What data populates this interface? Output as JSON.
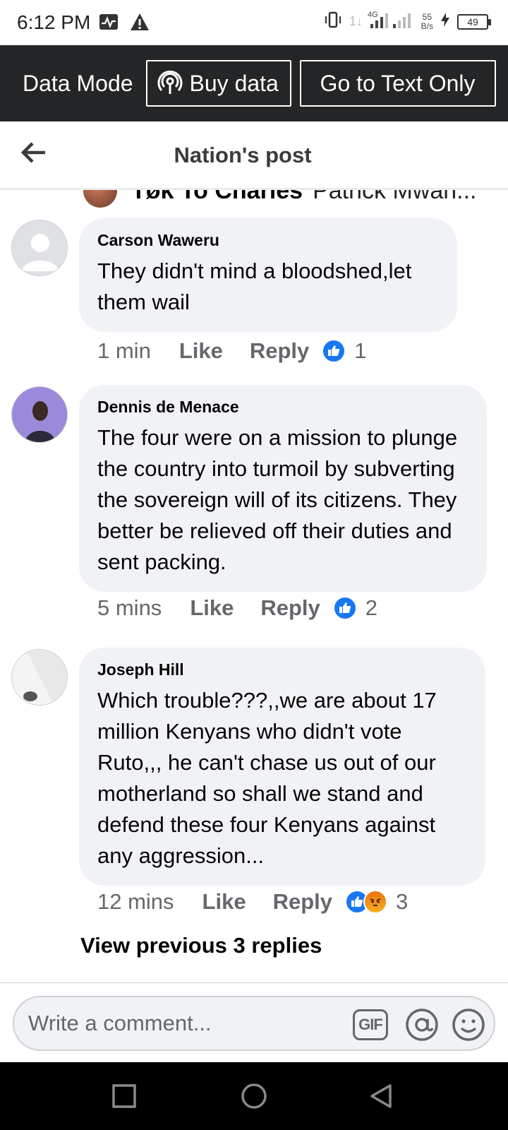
{
  "status_bar": {
    "time": "6:12 PM",
    "network_type": "4G",
    "net_speed_value": "55",
    "net_speed_unit": "B/s",
    "battery": "49"
  },
  "data_bar": {
    "mode_label": "Data Mode",
    "buy_label": "Buy data",
    "text_only_label": "Go to Text Only"
  },
  "header": {
    "title": "Nation's post"
  },
  "partial_comment": {
    "author": "Tøk To Charles",
    "text": "Patrick Mwan..."
  },
  "comments": [
    {
      "author": "Carson Waweru",
      "text": "They didn't mind a bloodshed,let them wail",
      "time": "1 min",
      "like_label": "Like",
      "reply_label": "Reply",
      "reaction_count": "1",
      "reactions": [
        "like"
      ]
    },
    {
      "author": "Dennis de Menace",
      "text": "The four were on a mission to plunge the country into turmoil by subverting the sovereign will of its citizens. They better be relieved off their duties and sent packing.",
      "time": "5 mins",
      "like_label": "Like",
      "reply_label": "Reply",
      "reaction_count": "2",
      "reactions": [
        "like"
      ]
    },
    {
      "author": "Joseph Hill",
      "text": "Which trouble???,,we are about 17 million Kenyans who didn't vote Ruto,,, he can't chase us out of our motherland so shall we stand and defend these four Kenyans against any aggression...",
      "time": "12 mins",
      "like_label": "Like",
      "reply_label": "Reply",
      "reaction_count": "3",
      "reactions": [
        "like",
        "angry"
      ]
    }
  ],
  "view_previous_label": "View previous 3 replies",
  "composer": {
    "placeholder": "Write a comment...",
    "gif_label": "GIF"
  },
  "colors": {
    "data_bar_bg": "#242526",
    "bubble_bg": "#f0f2f5",
    "like_blue": "#1877f2",
    "secondary_text": "#65676b"
  },
  "icons": [
    "activity-icon",
    "warning-icon",
    "vibrate-icon",
    "signal-icon",
    "charging-icon",
    "hotspot-icon",
    "back-arrow-icon",
    "like-reaction-icon",
    "angry-reaction-icon",
    "mention-icon",
    "emoji-icon",
    "recents-icon",
    "home-icon",
    "back-icon"
  ]
}
